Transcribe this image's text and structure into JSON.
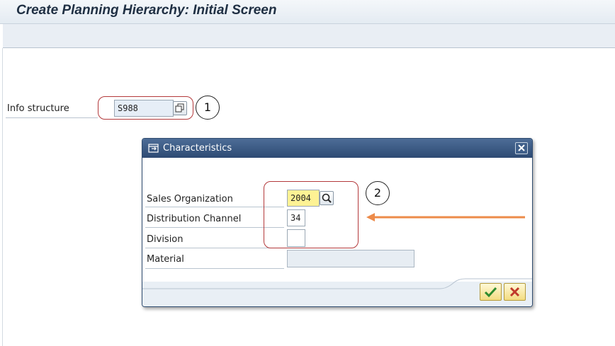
{
  "window": {
    "title": "Create Planning Hierarchy: Initial Screen"
  },
  "main": {
    "info_structure": {
      "label": "Info structure",
      "value": "S988"
    }
  },
  "annotations": {
    "marker_1": "1",
    "marker_2": "2"
  },
  "dialog": {
    "title": "Characteristics",
    "fields": {
      "sales_organization": {
        "label": "Sales Organization",
        "value": "2004"
      },
      "distribution_channel": {
        "label": "Distribution Channel",
        "value": "34"
      },
      "division": {
        "label": "Division",
        "value": ""
      },
      "material": {
        "label": "Material",
        "value": ""
      }
    }
  },
  "colors": {
    "title_bar_bg": "#2d4a73",
    "highlight_field": "#fef294",
    "annotation_red": "#b3393b",
    "arrow_orange": "#ed8b4a",
    "confirm_green": "#2e8b2e",
    "cancel_red": "#c0392b"
  },
  "icons": {
    "info_structure_button": "multiple-selection-icon",
    "sales_org_search": "search-icon",
    "dialog_title": "dialog-icon",
    "dialog_close": "close-icon",
    "confirm": "checkmark-icon",
    "cancel": "cancel-x-icon"
  }
}
